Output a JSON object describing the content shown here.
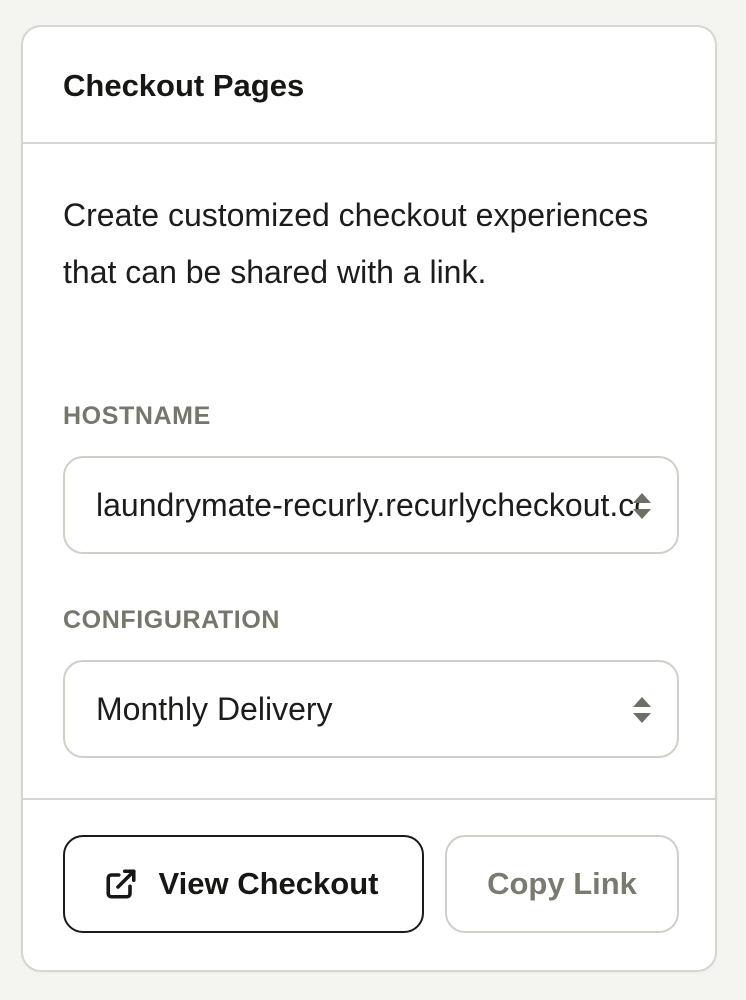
{
  "card": {
    "title": "Checkout Pages",
    "description": "Create customized checkout experiences that can be shared with a link."
  },
  "hostname": {
    "label": "HOSTNAME",
    "value": "laundrymate-recurly.recurlycheckout.com"
  },
  "configuration": {
    "label": "CONFIGURATION",
    "value": "Monthly Delivery"
  },
  "actions": {
    "view_checkout_label": "View Checkout",
    "view_checkout_icon": "external-link-icon",
    "copy_link_label": "Copy Link"
  },
  "colors": {
    "page_background": "#f4f4f0",
    "card_border": "#d6d6d0",
    "label_text": "#76766c",
    "disabled_text": "#7a7a70"
  }
}
